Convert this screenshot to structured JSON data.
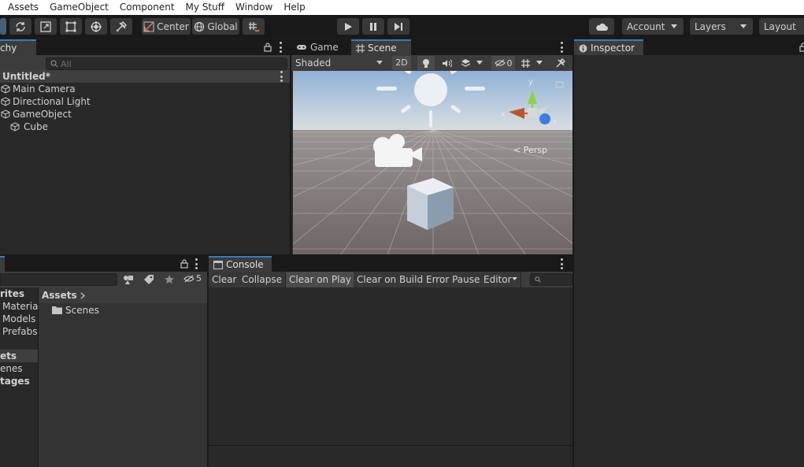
{
  "menu": [
    "Assets",
    "GameObject",
    "Component",
    "My Stuff",
    "Window",
    "Help"
  ],
  "toolbar": {
    "center_label": "Center",
    "global_label": "Global",
    "account_label": "Account",
    "layers_label": "Layers",
    "layout_label": "Layout"
  },
  "hierarchy": {
    "tab_label": "chy",
    "search_placeholder": "All",
    "scene_name": "Untitled*",
    "items": [
      "Main Camera",
      "Directional Light",
      "GameObject",
      "Cube"
    ]
  },
  "scene_panel": {
    "tabs": [
      "Game",
      "Scene"
    ],
    "shading_mode": "Shaded",
    "mode_2d": "2D",
    "hidden_count": "0",
    "persp_label": "< Persp",
    "gizmo_x": "x",
    "gizmo_y": "y",
    "gizmo_z": "z"
  },
  "inspector": {
    "tab_label": "Inspector"
  },
  "project": {
    "hidden_count": "5",
    "favorites_header": "rites",
    "favorites": [
      "Materia",
      "Models",
      "Prefabs"
    ],
    "assets_header": "ets",
    "assets_children": [
      "enes",
      "tages"
    ],
    "breadcrumb": "Assets",
    "folders": [
      "Scenes"
    ]
  },
  "console": {
    "tab_label": "Console",
    "buttons": [
      "Clear",
      "Collapse",
      "Clear on Play",
      "Clear on Build",
      "Error Pause",
      "Editor"
    ]
  },
  "colors": {
    "accent": "#3a79bb",
    "panel_bg": "#282828",
    "toolbar_bg": "#191919",
    "sky_top": "#8fb1d6",
    "ground": "#726a6a"
  },
  "icons": [
    "view-tool-icon",
    "rotate-tool-icon",
    "scale-tool-icon",
    "rect-tool-icon",
    "transform-tool-icon",
    "custom-tool-icon",
    "snap-icon",
    "play-icon",
    "pause-icon",
    "step-icon",
    "cloud-icon",
    "lock-icon",
    "cube-icon",
    "folder-icon",
    "light-icon",
    "audio-icon",
    "effects-icon",
    "visibility-icon",
    "grid-icon",
    "tools-icon",
    "search-icon",
    "sun-gizmo-icon",
    "camera-gizmo-icon",
    "info-icon",
    "console-icon"
  ]
}
